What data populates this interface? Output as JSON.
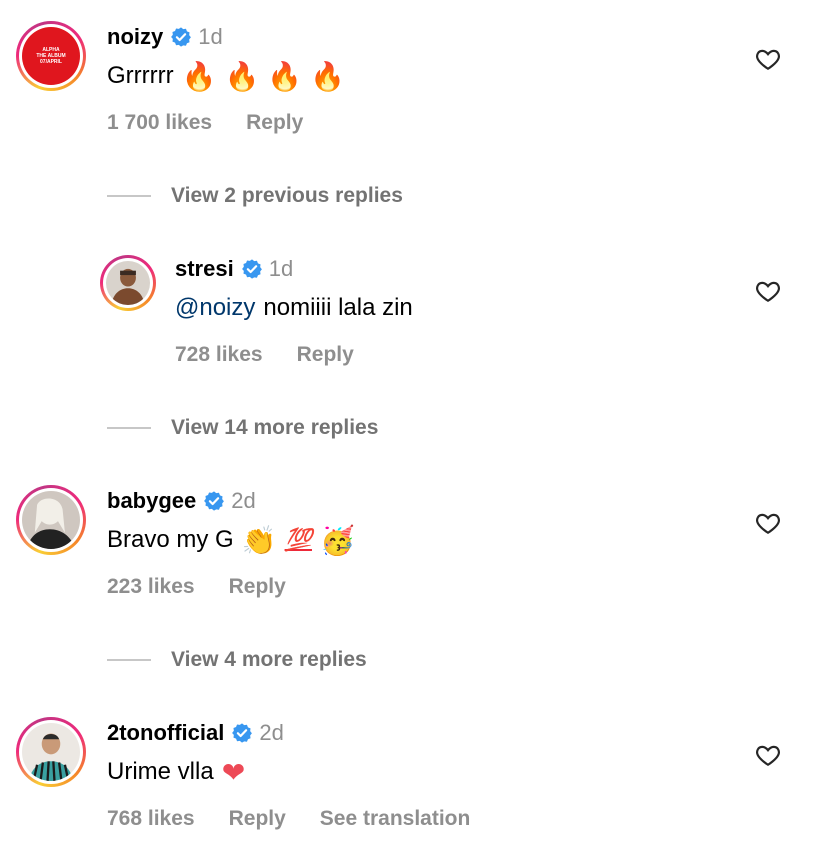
{
  "comments": [
    {
      "username": "noizy",
      "time": "1d",
      "text": "Grrrrrr",
      "emojis": [
        "🔥",
        "🔥",
        "🔥",
        "🔥"
      ],
      "likes": "1 700 likes",
      "reply": "Reply",
      "avatar": {
        "album_line1": "ALPHA",
        "album_line2": "THE ALBUM",
        "album_line3": "07/APRIL"
      }
    },
    {
      "username": "stresi",
      "time": "1d",
      "mention": "@noizy",
      "text": "nomiiii lala zin",
      "likes": "728 likes",
      "reply": "Reply"
    },
    {
      "username": "babygee",
      "time": "2d",
      "text": "Bravo my G",
      "emojis": [
        "👏",
        "💯",
        "🥳"
      ],
      "likes": "223 likes",
      "reply": "Reply"
    },
    {
      "username": "2tonofficial",
      "time": "2d",
      "text": "Urime vlla",
      "emojis": [
        "❤"
      ],
      "likes": "768 likes",
      "reply": "Reply",
      "translate": "See translation"
    }
  ],
  "view_replies": [
    "View 2 previous replies",
    "View 14 more replies",
    "View 4 more replies"
  ],
  "colors": {
    "verified": "#3897f0",
    "secondary_text": "#8e8e8e",
    "mention": "#00376b",
    "avatar_ring_start": "#f9ce34",
    "avatar_ring_mid": "#ee2a7b",
    "noizy_avatar_bg": "#e0161e"
  },
  "icons": {
    "verified": "verified-badge-icon",
    "heart": "heart-outline-icon"
  }
}
